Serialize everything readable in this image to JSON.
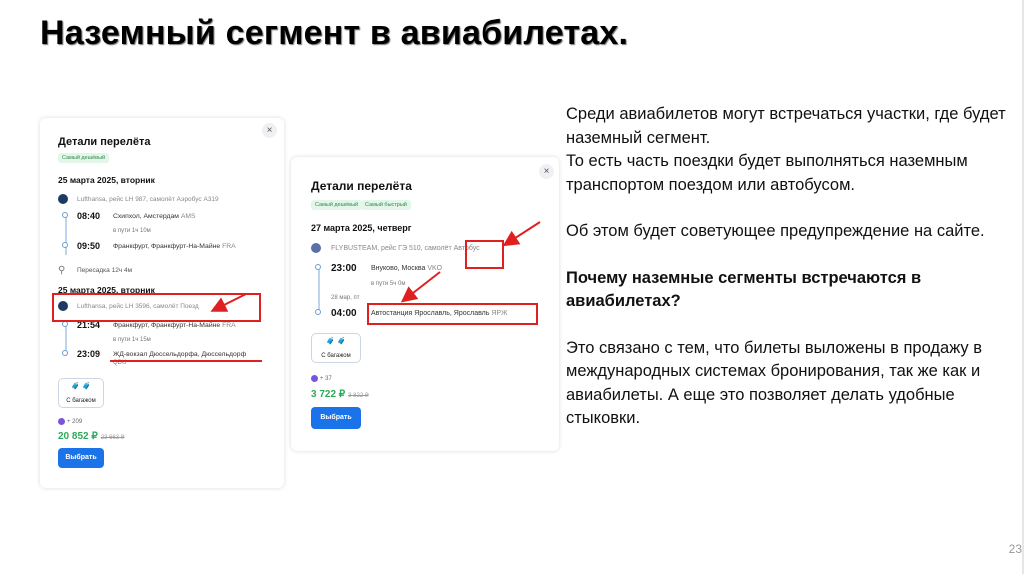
{
  "slide": {
    "title": "Наземный сегмент в авиабилетах.",
    "page_number": "23",
    "paragraphs": [
      "Среди авиабилетов могут встречаться участки, где будет наземный сегмент.",
      "То есть часть поездки будет выполняться наземным транспортом  поездом или автобусом.",
      "Об этом будет советующее предупреждение на сайте.",
      "Почему наземные сегменты встречаются в авиабилетах?",
      "Это связано с тем, что билеты выложены в продажу в международных системах бронирования, так же как и авиабилеты. А еще это позволяет делать удобные стыковки."
    ]
  },
  "card1": {
    "title": "Детали перелёта",
    "close": "×",
    "tag": "Самый дешёвый",
    "date1": "25 марта 2025, вторник",
    "airline1": "Lufthansa, рейс LH 987, самолёт Аэробус A319",
    "dep_time": "08:40",
    "dep_place": "Схипхол, Амстердам",
    "dep_code": "AMS",
    "dur1": "в пути 1ч 10м",
    "arr_time": "09:50",
    "arr_place": "Франкфурт, Франкфурт-На-Майне",
    "arr_code": "FRA",
    "transfer": "Пересадка 12ч 4м",
    "date2": "25 марта 2025, вторник",
    "airline2": "Lufthansa, рейс LH 3596, самолёт Поезд",
    "dep2_time": "21:54",
    "dep2_place": "Франкфурт, Франкфурт-На-Майне",
    "dep2_code": "FRA",
    "dur2": "в пути 1ч 15м",
    "arr2_time": "23:09",
    "arr2_place": "ЖД-вокзал Дюссельдорфа, Дюссельдорф",
    "arr2_code": "QDU",
    "baggage": "С багажом",
    "bonus": "+ 209",
    "price": "20 852 ₽",
    "old_price": "23 663 ₽",
    "button": "Выбрать"
  },
  "card2": {
    "title": "Детали перелёта",
    "close": "×",
    "tag1": "Самый дешёвый",
    "tag2": "Самый быстрый",
    "date": "27 марта 2025, четверг",
    "airline": "FLYBUSTEAM, рейс ГЭ 510, самолёт Автобус",
    "dep_time": "23:00",
    "dep_place": "Внуково, Москва",
    "dep_code": "VKO",
    "dur": "в пути 5ч 0м",
    "arr_date": "28 мар, пт",
    "arr_time": "04:00",
    "arr_place": "Автостанция Ярославль, Ярославль",
    "arr_code": "ЯРЖ",
    "baggage": "С багажом",
    "bonus": "+ 37",
    "price": "3 722 ₽",
    "old_price": "3 822 ₽",
    "button": "Выбрать"
  },
  "colors": {
    "accent_blue": "#1a73e8",
    "price_green": "#2faa5a",
    "annotation_red": "#e02020"
  },
  "icons": [
    "close-icon",
    "airline-logo-icon",
    "walk-icon",
    "baggage-icon",
    "bonus-icon",
    "arrow-icon"
  ]
}
